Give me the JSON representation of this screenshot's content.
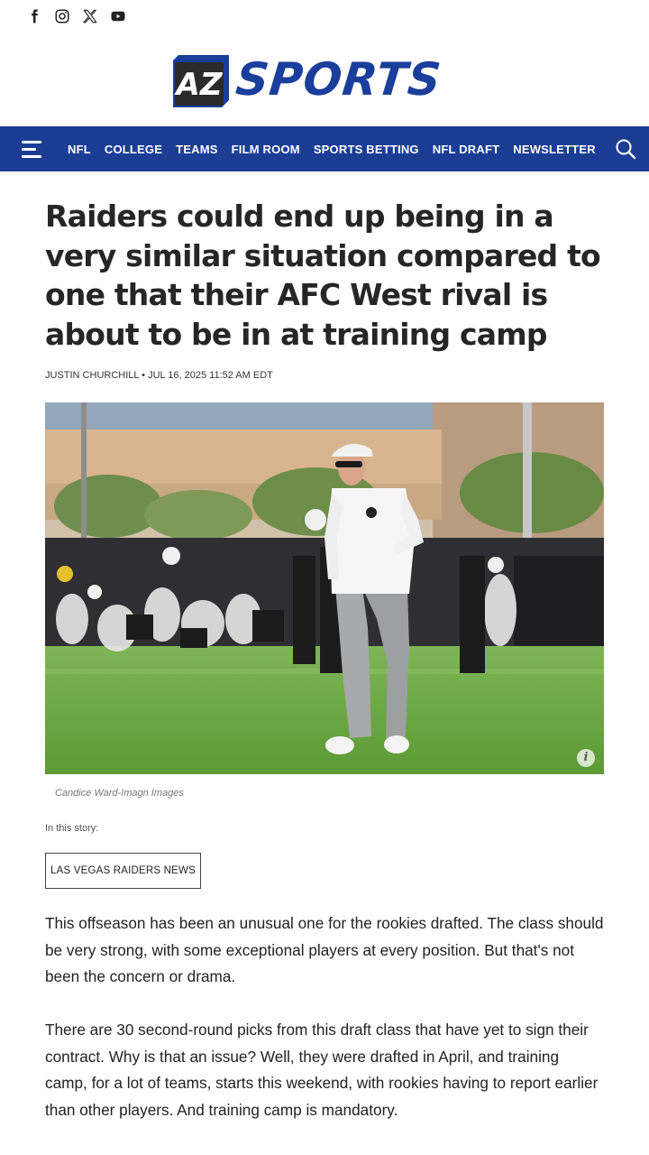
{
  "social": {
    "icons": [
      "facebook-icon",
      "instagram-icon",
      "x-icon",
      "youtube-icon"
    ]
  },
  "logo": {
    "badge_text": "AZ",
    "wordmark": "SPORTS",
    "brand_color": "#1a3e9b"
  },
  "nav": {
    "background": "#1b3e94",
    "items": [
      "NFL",
      "COLLEGE",
      "TEAMS",
      "FILM ROOM",
      "SPORTS BETTING",
      "NFL DRAFT",
      "NEWSLETTER"
    ]
  },
  "article": {
    "headline": "Raiders could end up being in a very similar situation compared to one that their AFC West rival is about to be in at training camp",
    "byline": "JUSTIN CHURCHILL • JUL 16, 2025 11:52 AM EDT",
    "photo_caption": "Candice Ward-Imagn Images",
    "story_label": "In this story:",
    "story_tag": "LAS VEGAS RAIDERS NEWS",
    "paragraphs": [
      "This offseason has been an unusual one for the rookies drafted. The class should be very strong, with some exceptional players at every position. But that's not been the concern or drama.",
      "There are 30 second-round picks from this draft class that have yet to sign their contract. Why is that an issue? Well, they were drafted in April, and training camp, for a lot of teams, starts this weekend, with rookies having to report earlier than other players. And training camp is mandatory."
    ]
  }
}
